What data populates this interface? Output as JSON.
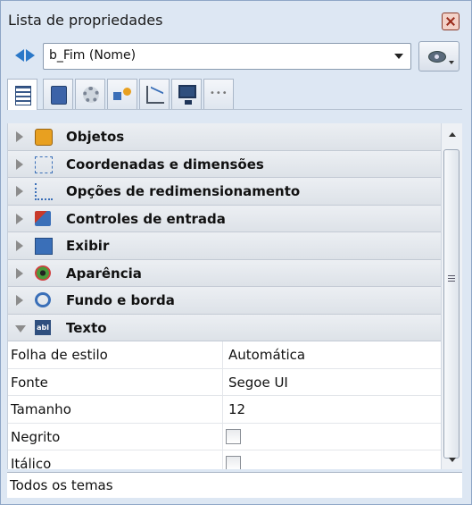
{
  "window": {
    "title": "Lista de propriedades"
  },
  "object_selector": {
    "value": "b_Fim (Nome)"
  },
  "tabs": [
    {
      "icon": "list-icon"
    },
    {
      "icon": "document-icon"
    },
    {
      "icon": "gear-icon"
    },
    {
      "icon": "shapes-icon"
    },
    {
      "icon": "chart-icon"
    },
    {
      "icon": "monitor-icon"
    },
    {
      "icon": "more-icon"
    }
  ],
  "categories": [
    {
      "label": "Objetos",
      "icon": "cube-icon",
      "expanded": false
    },
    {
      "label": "Coordenadas e dimensões",
      "icon": "coordinates-icon",
      "expanded": false
    },
    {
      "label": "Opções de redimensionamento",
      "icon": "resize-icon",
      "expanded": false
    },
    {
      "label": "Controles de entrada",
      "icon": "input-controls-icon",
      "expanded": false
    },
    {
      "label": "Exibir",
      "icon": "display-icon",
      "expanded": false
    },
    {
      "label": "Aparência",
      "icon": "eye-icon",
      "expanded": false
    },
    {
      "label": "Fundo e borda",
      "icon": "background-border-icon",
      "expanded": false
    },
    {
      "label": "Texto",
      "icon": "text-icon",
      "expanded": true
    }
  ],
  "properties": [
    {
      "name": "Folha de estilo",
      "value": "Automática"
    },
    {
      "name": "Fonte",
      "value": "Segoe UI"
    },
    {
      "name": "Tamanho",
      "value": "12"
    },
    {
      "name": "Negrito",
      "checked": false
    },
    {
      "name": "Itálico",
      "checked": false
    }
  ],
  "statusbar": {
    "text": "Todos os temas"
  }
}
